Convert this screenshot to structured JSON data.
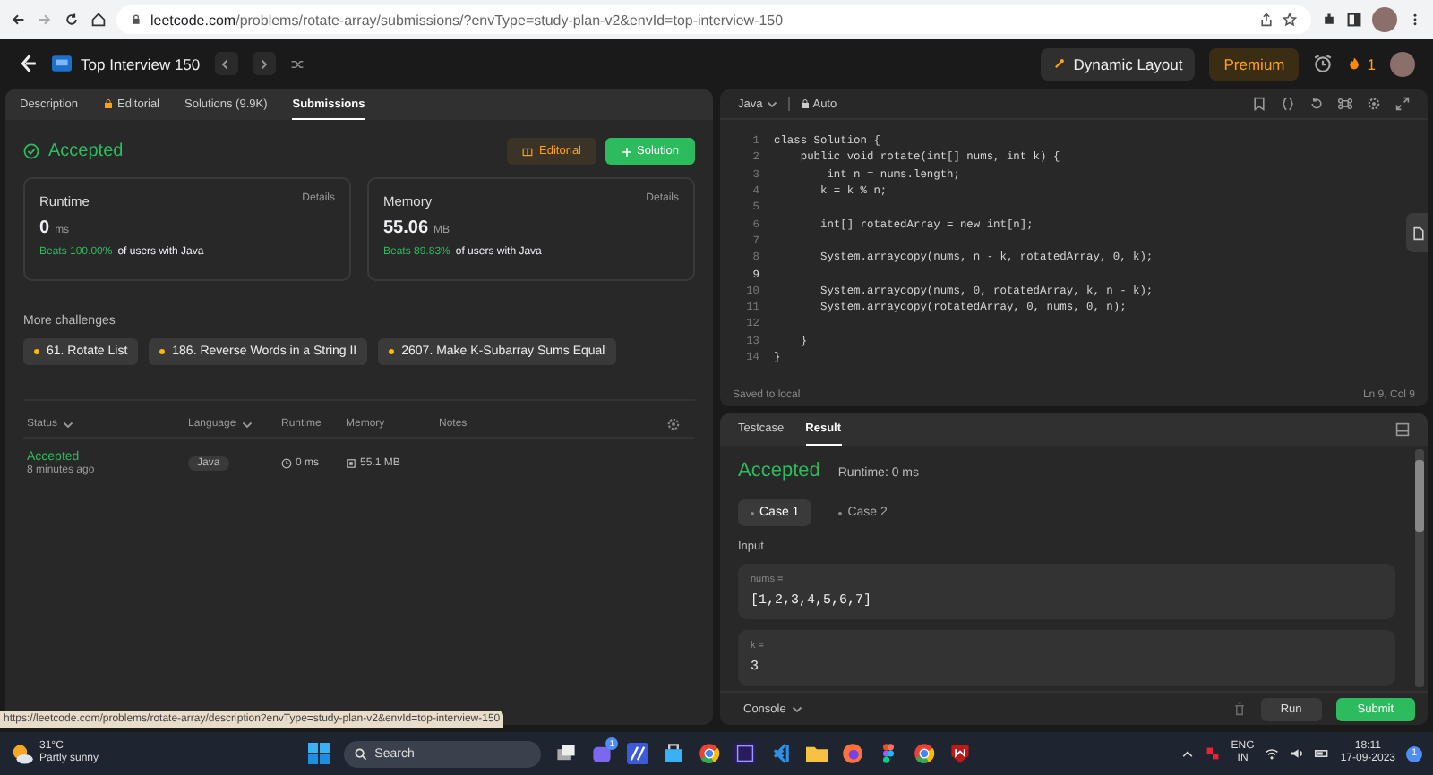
{
  "browser": {
    "url_host": "leetcode.com",
    "url_path": "/problems/rotate-array/submissions/?envType=study-plan-v2&envId=top-interview-150"
  },
  "header": {
    "study_plan": "Top Interview 150",
    "dynamic_layout": "Dynamic Layout",
    "premium": "Premium",
    "streak": "1"
  },
  "left_tabs": [
    {
      "label": "Description",
      "selected": false,
      "locked": false
    },
    {
      "label": "Editorial",
      "selected": false,
      "locked": true
    },
    {
      "label": "Solutions (9.9K)",
      "selected": false,
      "locked": false
    },
    {
      "label": "Submissions",
      "selected": true,
      "locked": false
    }
  ],
  "submission": {
    "status": "Accepted",
    "editorial_button": "Editorial",
    "solution_button": "Solution"
  },
  "stats": [
    {
      "title": "Runtime",
      "details": "Details",
      "value": "0",
      "unit": "ms",
      "beats": "Beats 100.00%",
      "suffix": "of users with Java"
    },
    {
      "title": "Memory",
      "details": "Details",
      "value": "55.06",
      "unit": "MB",
      "beats": "Beats 89.83%",
      "suffix": "of users with Java"
    }
  ],
  "more_challenges": {
    "title": "More challenges",
    "items": [
      "61. Rotate List",
      "186. Reverse Words in a String II",
      "2607. Make K-Subarray Sums Equal"
    ]
  },
  "submissions_table": {
    "columns": [
      {
        "label": "Status",
        "sortable": true
      },
      {
        "label": "Language",
        "sortable": true
      },
      {
        "label": "Runtime",
        "sortable": false
      },
      {
        "label": "Memory",
        "sortable": false
      },
      {
        "label": "Notes",
        "sortable": false
      }
    ],
    "rows": [
      {
        "status": "Accepted",
        "time": "8 minutes ago",
        "language": "Java",
        "runtime": "0 ms",
        "memory": "55.1 MB"
      }
    ]
  },
  "editor": {
    "language": "Java",
    "mode": "Auto",
    "saved": "Saved to local",
    "position": "Ln 9, Col 9",
    "lines": [
      {
        "number": "1",
        "code": "class Solution {"
      },
      {
        "number": "2",
        "code": "    public void rotate(int[] nums, int k) {"
      },
      {
        "number": "3",
        "code": "        int n = nums.length;"
      },
      {
        "number": "4",
        "code": "       k = k % n;"
      },
      {
        "number": "5"
      },
      {
        "number": "6",
        "code": "       int[] rotatedArray = new int[n];"
      },
      {
        "number": "7"
      },
      {
        "number": "8",
        "code": "       System.arraycopy(nums, n - k, rotatedArray, 0, k);"
      },
      {
        "number": "9"
      },
      {
        "number": "10",
        "code": "       System.arraycopy(nums, 0, rotatedArray, k, n - k);"
      },
      {
        "number": "11",
        "code": "       System.arraycopy(rotatedArray, 0, nums, 0, n);"
      },
      {
        "number": "12"
      },
      {
        "number": "13",
        "code": "    }"
      },
      {
        "number": "14",
        "code": "}"
      }
    ]
  },
  "result_tabs": [
    {
      "label": "Testcase",
      "selected": false
    },
    {
      "label": "Result",
      "selected": true
    }
  ],
  "result": {
    "verdict": "Accepted",
    "runtime": "Runtime: 0 ms",
    "cases": [
      {
        "label": "Case 1",
        "selected": true
      },
      {
        "label": "Case 2",
        "selected": false
      }
    ],
    "input_label": "Input",
    "inputs": [
      {
        "name": "nums =",
        "value": "[1,2,3,4,5,6,7]"
      },
      {
        "name": "k =",
        "value": "3"
      }
    ],
    "console": "Console",
    "run": "Run",
    "submit": "Submit"
  },
  "status_link": "https://leetcode.com/problems/rotate-array/description?envType=study-plan-v2&envId=top-interview-150",
  "taskbar": {
    "temperature": "31°C",
    "weather": "Partly sunny",
    "search": "Search",
    "teams_badge": "1",
    "language": "ENG",
    "region": "IN",
    "time": "18:11",
    "date": "17-09-2023",
    "notifications": "1"
  }
}
